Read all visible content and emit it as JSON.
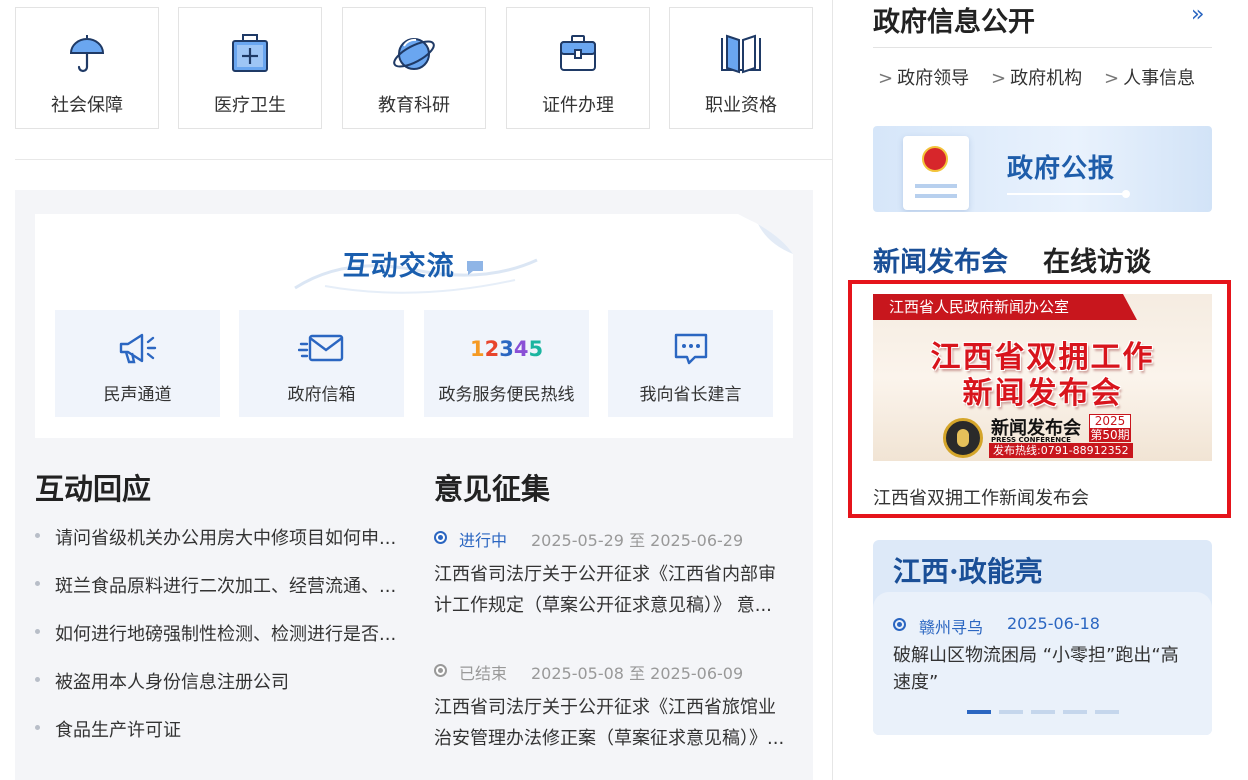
{
  "services": [
    {
      "label": "社会保障",
      "icon": "umbrella-icon"
    },
    {
      "label": "医疗卫生",
      "icon": "medical-kit-icon"
    },
    {
      "label": "教育科研",
      "icon": "planet-icon"
    },
    {
      "label": "证件办理",
      "icon": "briefcase-icon"
    },
    {
      "label": "职业资格",
      "icon": "book-icon"
    }
  ],
  "interaction": {
    "title": "互动交流",
    "items": [
      {
        "label": "民声通道",
        "icon": "megaphone-icon"
      },
      {
        "label": "政府信箱",
        "icon": "mail-icon"
      },
      {
        "label": "政务服务便民热线",
        "icon_text": "12345"
      },
      {
        "label": "我向省长建言",
        "icon": "chat-bubble-icon"
      }
    ]
  },
  "responses": {
    "heading": "互动回应",
    "items": [
      "请问省级机关办公用房大中修项目如何申...",
      "斑兰食品原料进行二次加工、经营流通、...",
      "如何进行地磅强制性检测、检测进行是否...",
      "被盗用本人身份信息注册公司",
      "食品生产许可证"
    ]
  },
  "opinions": {
    "heading": "意见征集",
    "items": [
      {
        "status": "进行中",
        "dates": "2025-05-29 至 2025-06-29",
        "line1": "江西省司法厅关于公开征求《江西省内部审",
        "line2": "计工作规定（草案公开征求意见稿）》 意..."
      },
      {
        "status": "已结束",
        "dates": "2025-05-08 至 2025-06-09",
        "line1": "江西省司法厅关于公开征求《江西省旅馆业",
        "line2": "治安管理办法修正案（草案征求意见稿）》..."
      }
    ]
  },
  "right": {
    "title": "政府信息公开",
    "more": "»",
    "links": [
      "政府领导",
      "政府机构",
      "人事信息"
    ],
    "gazette": "政府公报",
    "tabs": [
      "新闻发布会",
      "在线访谈"
    ],
    "press": {
      "band": "江西省人民政府新闻办公室",
      "headline1": "江西省双拥工作",
      "headline2": "新闻发布会",
      "logo_text": "新闻发布会",
      "logo_sub": "PRESS CONFERENCE",
      "year": "2025年",
      "issue": "第50期",
      "hotline": "发布热线:0791-88912352",
      "caption": "江西省双拥工作新闻发布会"
    },
    "jx": {
      "title": "江西·政能亮",
      "source": "赣州寻乌",
      "date": "2025-06-18",
      "text": "破解山区物流困局 “小零担”跑出“高速度”",
      "pager_count": 5,
      "pager_active": 1
    }
  }
}
